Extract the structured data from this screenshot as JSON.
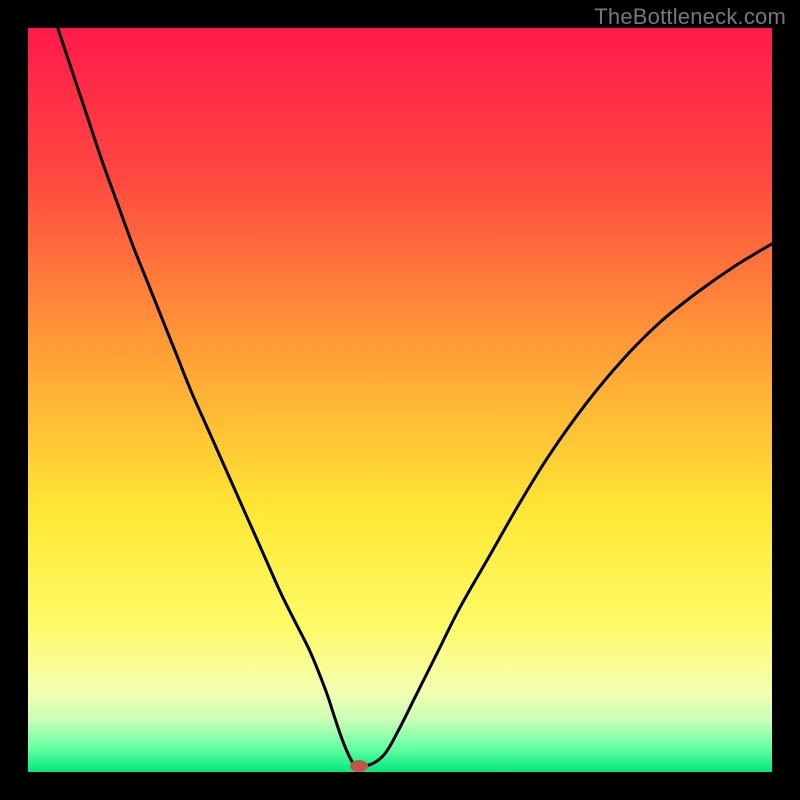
{
  "watermark": "TheBottleneck.com",
  "chart_data": {
    "type": "line",
    "title": "",
    "xlabel": "",
    "ylabel": "",
    "xlim": [
      0,
      100
    ],
    "ylim": [
      0,
      100
    ],
    "gradient_stops": [
      {
        "offset": 0,
        "color": "#ff1a4b"
      },
      {
        "offset": 20,
        "color": "#ff4840"
      },
      {
        "offset": 45,
        "color": "#ffa436"
      },
      {
        "offset": 65,
        "color": "#ffe734"
      },
      {
        "offset": 80,
        "color": "#fffb66"
      },
      {
        "offset": 89,
        "color": "#f4ffb0"
      },
      {
        "offset": 93,
        "color": "#c9ffb8"
      },
      {
        "offset": 97,
        "color": "#5fffa2"
      },
      {
        "offset": 100,
        "color": "#00e87c"
      }
    ],
    "series": [
      {
        "name": "curve",
        "x": [
          4,
          6,
          8,
          10,
          12,
          14,
          16,
          18,
          20,
          22,
          24,
          26,
          28,
          30,
          32,
          34,
          36,
          38,
          40,
          41,
          42,
          43,
          44,
          46,
          48,
          50,
          52,
          55,
          58,
          62,
          66,
          70,
          75,
          80,
          85,
          90,
          95,
          100
        ],
        "y": [
          100,
          94,
          88,
          82,
          76.5,
          71,
          66,
          61,
          56,
          51,
          46.5,
          42,
          37.5,
          33,
          28.5,
          24,
          20,
          16,
          11,
          8,
          5,
          2.5,
          1,
          1,
          2.5,
          6,
          10,
          16,
          22,
          29,
          36,
          42.5,
          49.5,
          55.5,
          60.5,
          64.5,
          68,
          71
        ]
      }
    ],
    "marker": {
      "x": 44.5,
      "y": 0.8,
      "color": "#c0564b"
    }
  }
}
